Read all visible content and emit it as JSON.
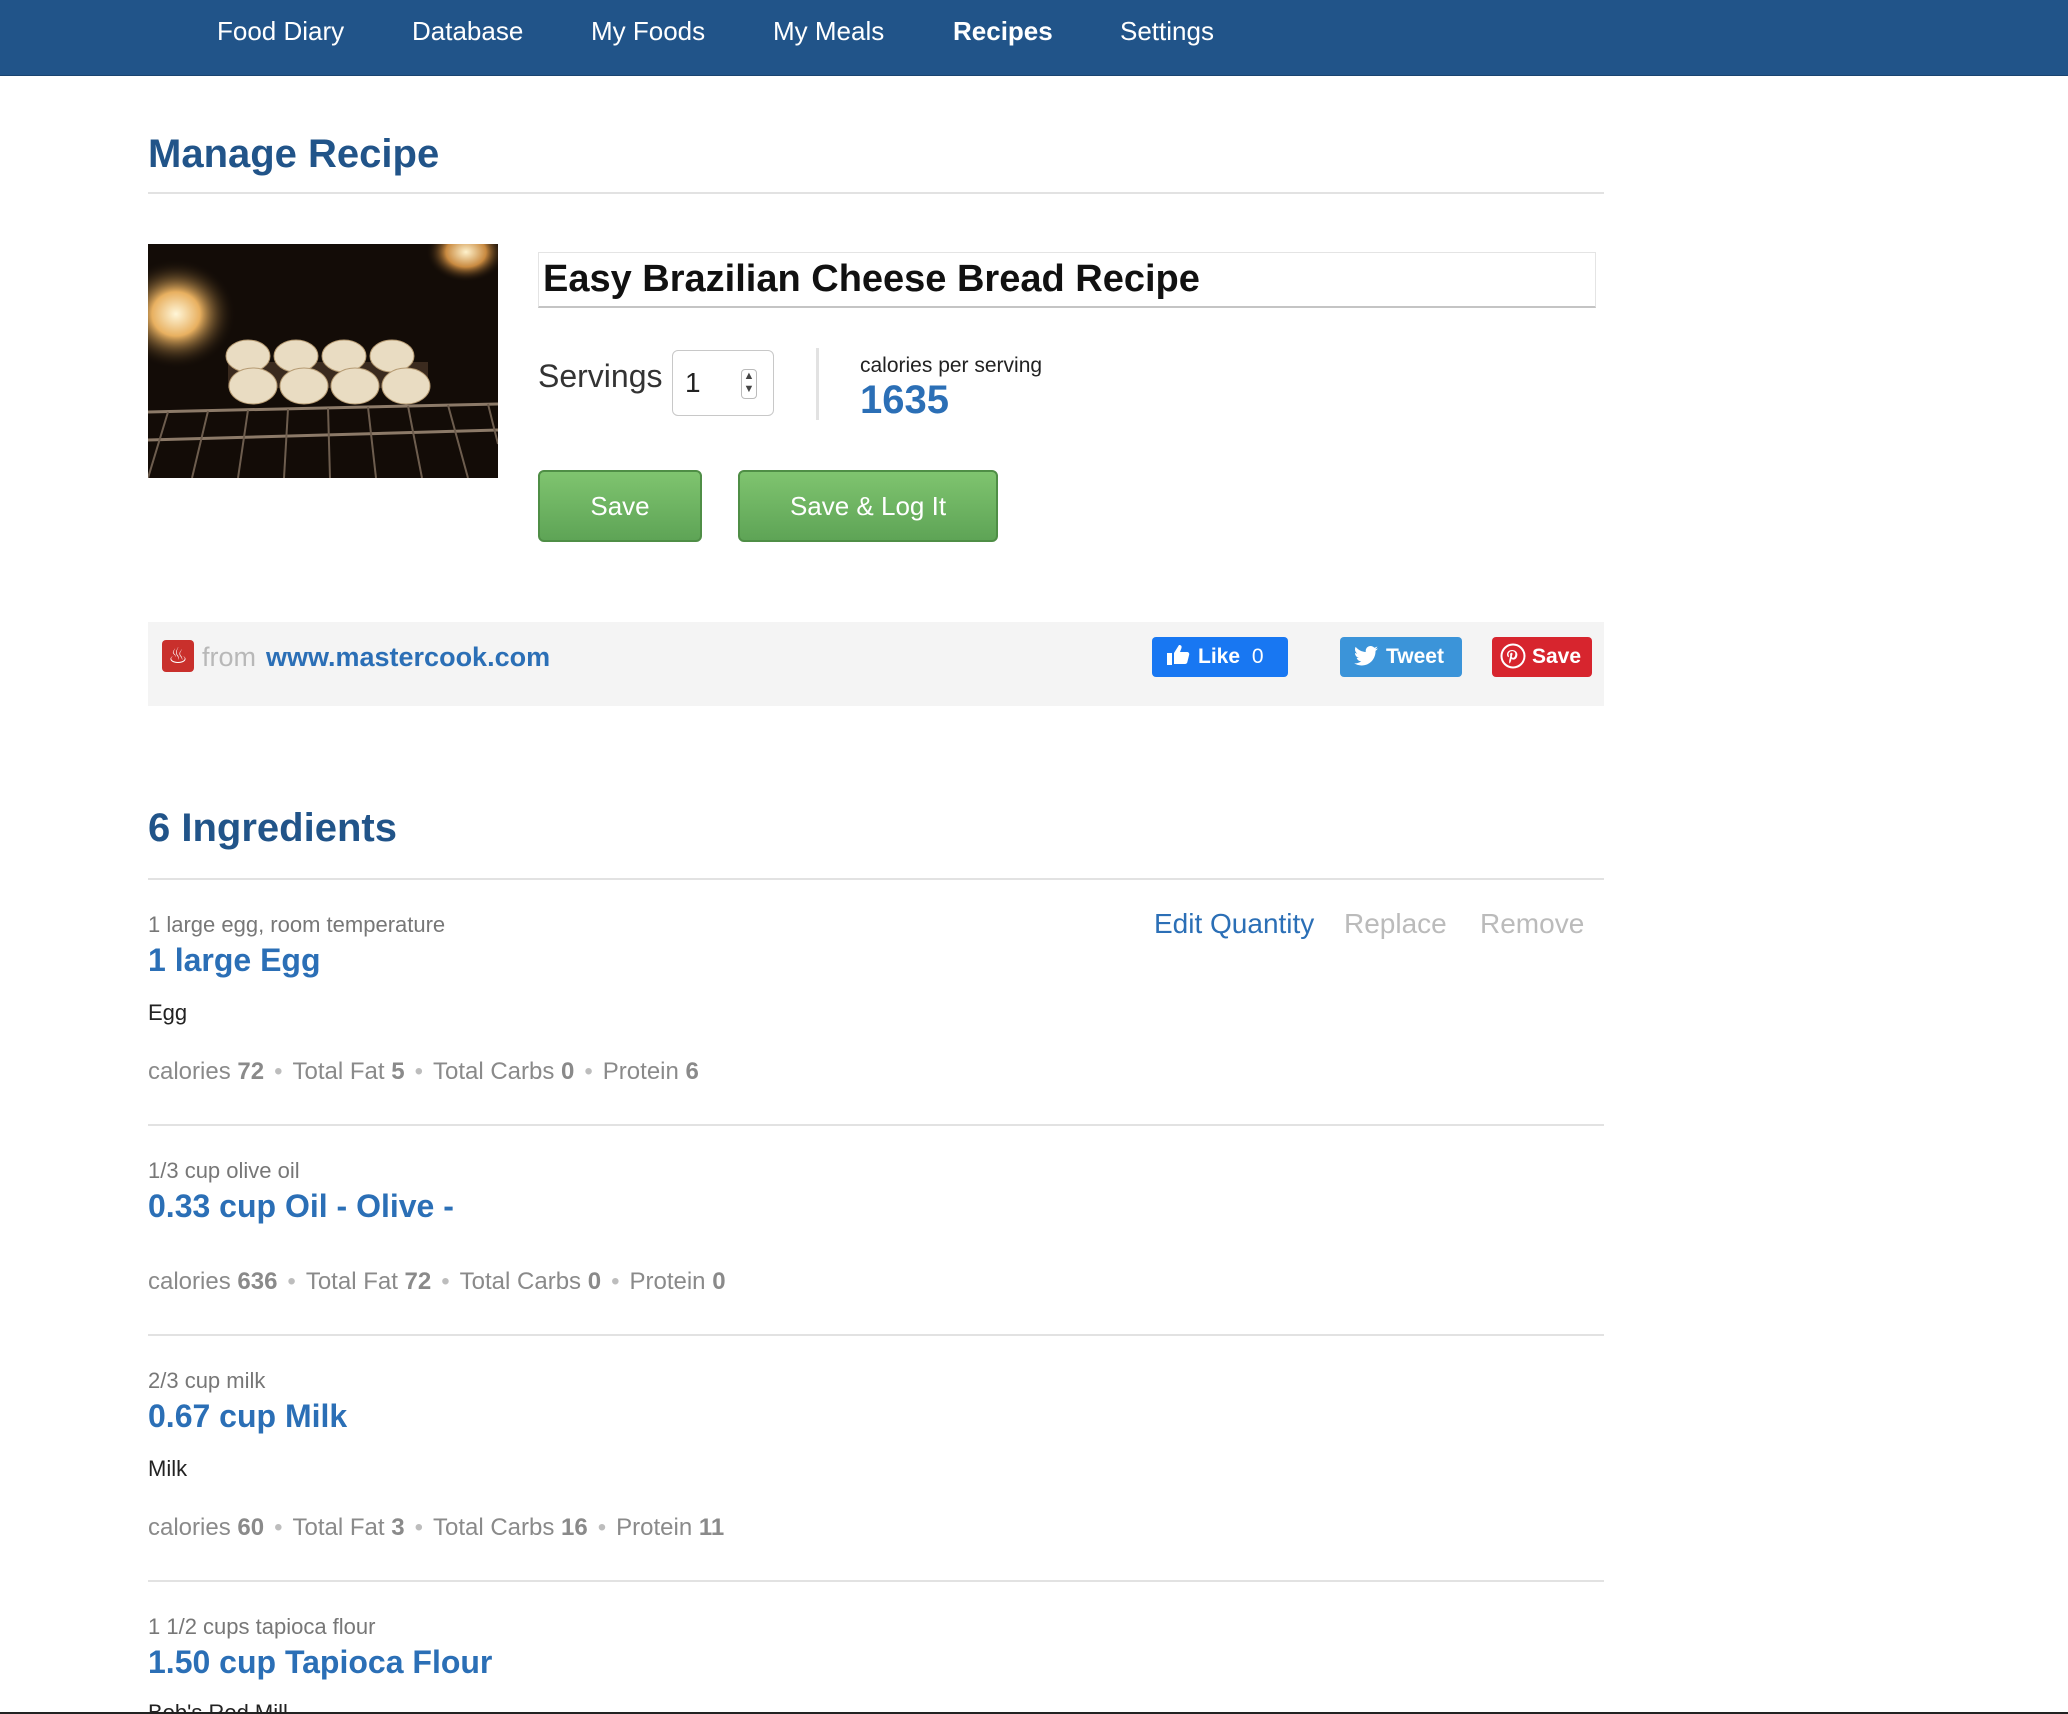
{
  "nav": {
    "items": [
      {
        "label": "Food Diary"
      },
      {
        "label": "Database"
      },
      {
        "label": "My Foods"
      },
      {
        "label": "My Meals"
      },
      {
        "label": "Recipes",
        "active": true
      },
      {
        "label": "Settings"
      }
    ]
  },
  "page": {
    "title": "Manage Recipe"
  },
  "recipe": {
    "name": "Easy Brazilian Cheese Bread Recipe",
    "servings_label": "Servings",
    "servings_value": "1",
    "calories_label": "calories per serving",
    "calories_value": "1635",
    "save_label": "Save",
    "save_log_label": "Save & Log It"
  },
  "source": {
    "from_label": "from",
    "site": "www.mastercook.com"
  },
  "share": {
    "like_label": "Like",
    "like_count": "0",
    "tweet_label": "Tweet",
    "pin_label": "Save"
  },
  "ingredients_section": {
    "title": "6 Ingredients",
    "actions": {
      "edit": "Edit Quantity",
      "replace": "Replace",
      "remove": "Remove"
    },
    "labels": {
      "calories": "calories",
      "fat": "Total Fat",
      "carbs": "Total Carbs",
      "protein": "Protein"
    },
    "items": [
      {
        "original": "1 large egg, room temperature",
        "name": "1 large Egg",
        "description": "Egg",
        "calories": "72",
        "fat": "5",
        "carbs": "0",
        "protein": "6"
      },
      {
        "original": "1/3 cup olive oil",
        "name": "0.33 cup Oil - Olive -",
        "description": "",
        "calories": "636",
        "fat": "72",
        "carbs": "0",
        "protein": "0"
      },
      {
        "original": "2/3 cup milk",
        "name": "0.67 cup Milk",
        "description": "Milk",
        "calories": "60",
        "fat": "3",
        "carbs": "16",
        "protein": "11"
      },
      {
        "original": "1 1/2 cups tapioca flour",
        "name": "1.50 cup Tapioca Flour",
        "description": "Bob's Red Mill"
      }
    ]
  },
  "colors": {
    "nav_bg": "#215489",
    "heading": "#215489",
    "link": "#2b6fb6",
    "button_green": "#5ea456",
    "facebook": "#1877f2",
    "twitter": "#1da1f2",
    "pinterest": "#e60023"
  }
}
